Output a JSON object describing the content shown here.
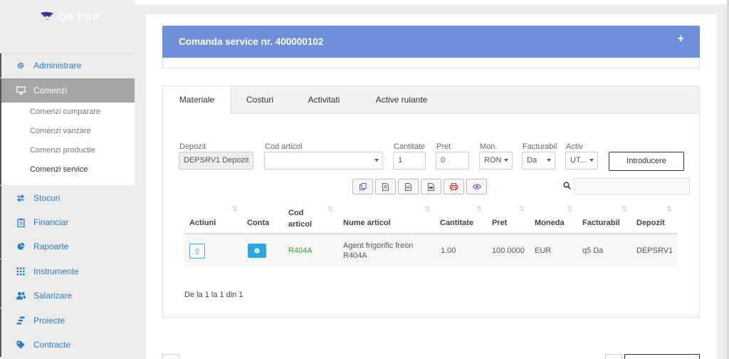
{
  "app": {
    "name": "Q5 ERP",
    "logo_mark_text": "Q5"
  },
  "sidebar": {
    "items": [
      {
        "label": "Administrare",
        "icon": "gear-icon"
      },
      {
        "label": "Comenzi",
        "icon": "monitor-icon",
        "active": true
      },
      {
        "label": "Stocuri",
        "icon": "arrows-icon"
      },
      {
        "label": "Financiar",
        "icon": "clipboard-icon"
      },
      {
        "label": "Rapoarte",
        "icon": "pie-chart-icon"
      },
      {
        "label": "Instrumente",
        "icon": "grid-icon"
      },
      {
        "label": "Salarizare",
        "icon": "users-icon"
      },
      {
        "label": "Proiecte",
        "icon": "gantt-icon"
      },
      {
        "label": "Contracte",
        "icon": "tag-icon"
      }
    ],
    "sub_items": [
      {
        "label": "Comenzi cumparare"
      },
      {
        "label": "Comenzi vanzare"
      },
      {
        "label": "Comenzi productie"
      },
      {
        "label": "Comenzi service",
        "current": true
      }
    ]
  },
  "panel": {
    "title": "Comanda service nr. 400000102",
    "expand_symbol": "+"
  },
  "tabs": [
    {
      "label": "Materiale",
      "active": true
    },
    {
      "label": "Costuri"
    },
    {
      "label": "Activitati"
    },
    {
      "label": "Active rulante"
    }
  ],
  "form": {
    "depozit": {
      "label": "Depozit",
      "value": "DEPSRV1 Depozit"
    },
    "cod_articol": {
      "label": "Cod articol",
      "value": ""
    },
    "cantitate": {
      "label": "Cantitate",
      "value": "1"
    },
    "pret": {
      "label": "Pret",
      "value": "0"
    },
    "mon": {
      "label": "Mon.",
      "value": "RON"
    },
    "facturabil": {
      "label": "Facturabil",
      "value": "Da"
    },
    "activ": {
      "label": "Activ",
      "value": "UT..."
    },
    "submit_label": "Introducere"
  },
  "toolbar": {
    "buttons": [
      "copy-icon",
      "pdf-icon",
      "document-icon",
      "pdf-export-icon",
      "print-icon",
      "eye-icon"
    ],
    "search_icon": "search-icon",
    "search_value": ""
  },
  "table": {
    "columns": [
      "Actiuni",
      "Conta",
      "Cod\narticol",
      "Nume articol",
      "Cantitate",
      "Pret",
      "Moneda",
      "Facturabil",
      "Depozit"
    ],
    "rows": [
      {
        "cod": "R404A",
        "nume": "Agent frigorific freon R404A",
        "cantitate": "1.00",
        "pret": "100.0000",
        "moneda": "EUR",
        "facturabil": "q5 Da",
        "depozit": "DEPSRV1"
      }
    ],
    "pager": "De la 1 la 1 din 1"
  },
  "colors": {
    "panel_header": "#6f8fd9",
    "accent": "#2b7cc4",
    "conta_button": "#2aa6de",
    "code_green": "#3a9a3a"
  }
}
